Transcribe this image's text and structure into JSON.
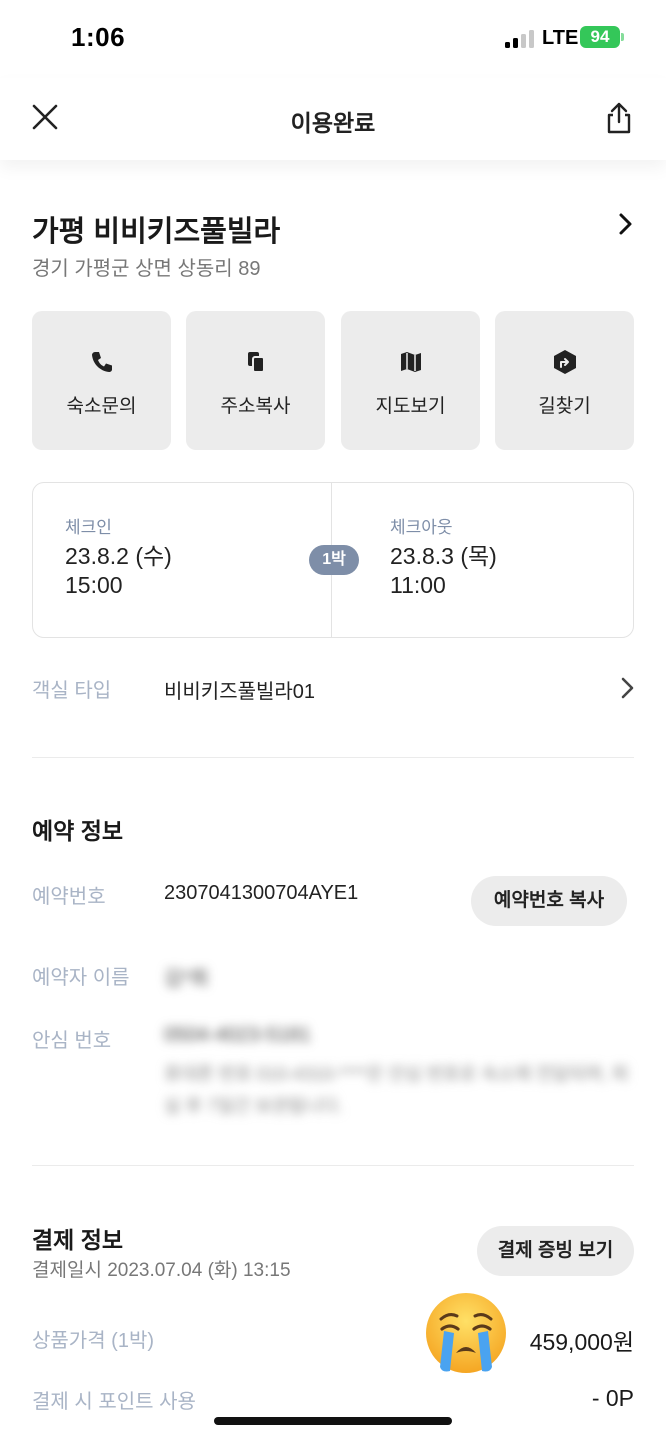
{
  "status_bar": {
    "time": "1:06",
    "network": "LTE",
    "battery": "94"
  },
  "header": {
    "title": "이용완료"
  },
  "hotel": {
    "name": "가평 비비키즈풀빌라",
    "address": "경기 가평군 상면 상동리 89"
  },
  "actions": [
    {
      "label": "숙소문의",
      "icon": "phone-icon"
    },
    {
      "label": "주소복사",
      "icon": "copy-icon"
    },
    {
      "label": "지도보기",
      "icon": "map-icon"
    },
    {
      "label": "길찾기",
      "icon": "directions-icon"
    }
  ],
  "stay": {
    "checkin_label": "체크인",
    "checkin_date": "23.8.2 (수)",
    "checkin_time": "15:00",
    "nights": "1박",
    "checkout_label": "체크아웃",
    "checkout_date": "23.8.3 (목)",
    "checkout_time": "11:00"
  },
  "room": {
    "label": "객실 타입",
    "value": "비비키즈풀빌라01"
  },
  "reservation": {
    "title": "예약 정보",
    "number_label": "예약번호",
    "number": "2307041300704AYE1",
    "copy_button": "예약번호 복사",
    "name_label": "예약자 이름",
    "name": "김*희",
    "safe_label": "안심 번호",
    "safe_number": "0504-4023-5181",
    "safe_note": "휴대폰 번호 010-4310-****은 안심 번호로 숙소에 전달되며, 퇴실 후 7일간 보관됩니다."
  },
  "payment": {
    "title": "결제 정보",
    "date": "결제일시 2023.07.04 (화) 13:15",
    "receipt_button": "결제 증빙 보기",
    "price_label": "상품가격 (1박)",
    "price": "459,000원",
    "points_label": "결제 시 포인트 사용",
    "points": "- 0P"
  },
  "colors": {
    "accent_label": "#7e8ea8",
    "button_bg": "#ececec",
    "battery": "#34c759"
  }
}
